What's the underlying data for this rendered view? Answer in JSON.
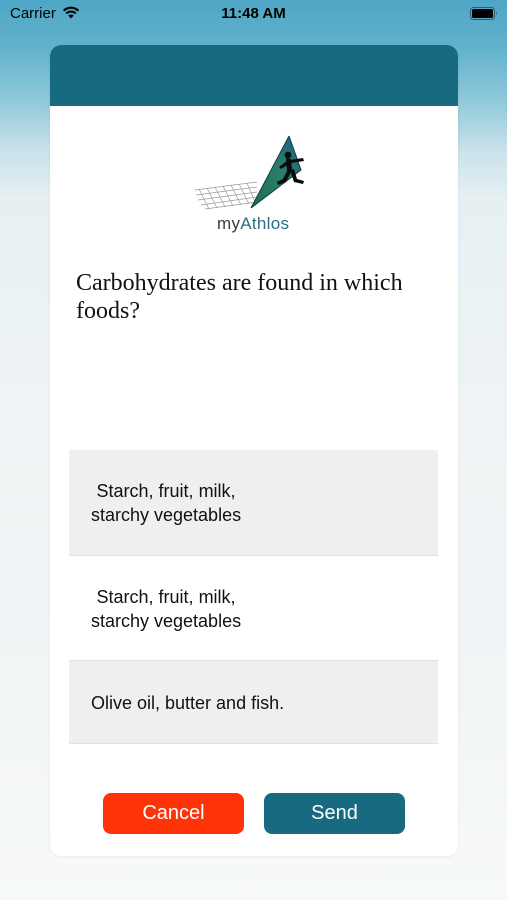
{
  "status_bar": {
    "carrier": "Carrier",
    "time": "11:48 AM"
  },
  "logo": {
    "text_my": "my",
    "text_athlos": "Athlos"
  },
  "question": "Carbohydrates are found in which foods?",
  "options": [
    {
      "label": "Starch, fruit, milk,\nstarchy vegetables"
    },
    {
      "label": "Starch, fruit, milk,\nstarchy vegetables"
    },
    {
      "label": "Olive oil, butter and fish."
    }
  ],
  "buttons": {
    "cancel": "Cancel",
    "send": "Send"
  },
  "colors": {
    "header": "#176a7f",
    "cancel": "#ff3308",
    "send": "#176a7f",
    "option_shaded": "#efefef"
  },
  "icons": [
    "wifi-icon",
    "battery-icon",
    "myathlos-logo"
  ]
}
